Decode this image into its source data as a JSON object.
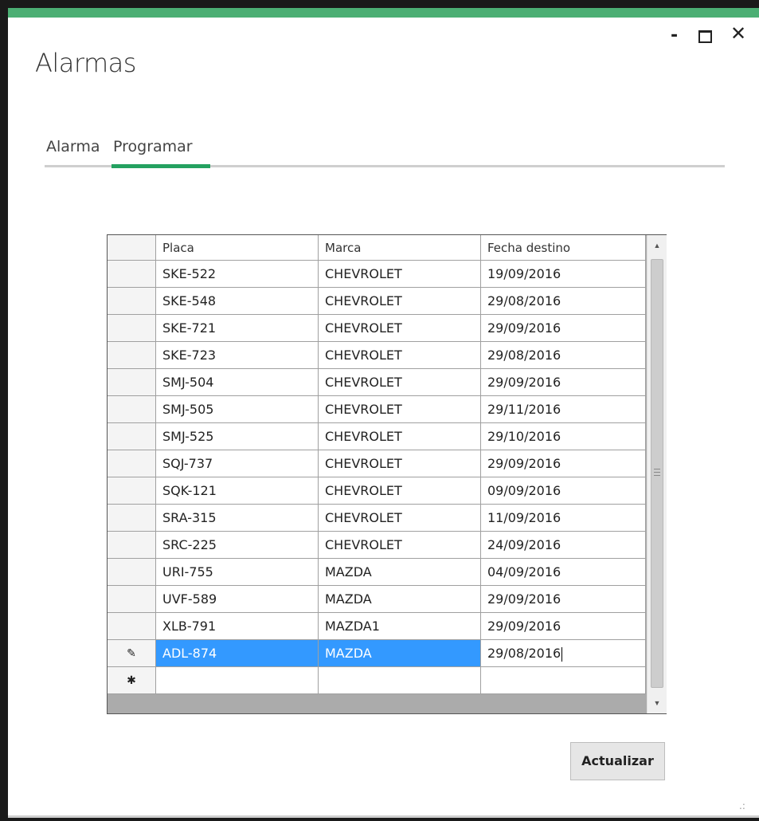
{
  "window": {
    "title": "Alarmas",
    "minimize_glyph": "-",
    "close_glyph": "✕"
  },
  "tabs": [
    {
      "label": "Alarma",
      "active": false
    },
    {
      "label": "Programar",
      "active": true
    }
  ],
  "grid": {
    "columns": [
      "Placa",
      "Marca",
      "Fecha destino"
    ],
    "rows": [
      {
        "placa": "SKE-522",
        "marca": "CHEVROLET",
        "fecha": "19/09/2016"
      },
      {
        "placa": "SKE-548",
        "marca": "CHEVROLET",
        "fecha": "29/08/2016"
      },
      {
        "placa": "SKE-721",
        "marca": "CHEVROLET",
        "fecha": "29/09/2016"
      },
      {
        "placa": "SKE-723",
        "marca": "CHEVROLET",
        "fecha": "29/08/2016"
      },
      {
        "placa": "SMJ-504",
        "marca": "CHEVROLET",
        "fecha": "29/09/2016"
      },
      {
        "placa": "SMJ-505",
        "marca": "CHEVROLET",
        "fecha": "29/11/2016"
      },
      {
        "placa": "SMJ-525",
        "marca": "CHEVROLET",
        "fecha": "29/10/2016"
      },
      {
        "placa": "SQJ-737",
        "marca": "CHEVROLET",
        "fecha": "29/09/2016"
      },
      {
        "placa": "SQK-121",
        "marca": "CHEVROLET",
        "fecha": "09/09/2016"
      },
      {
        "placa": "SRA-315",
        "marca": "CHEVROLET",
        "fecha": "11/09/2016"
      },
      {
        "placa": "SRC-225",
        "marca": "CHEVROLET",
        "fecha": "24/09/2016"
      },
      {
        "placa": "URI-755",
        "marca": "MAZDA",
        "fecha": "04/09/2016"
      },
      {
        "placa": "UVF-589",
        "marca": "MAZDA",
        "fecha": "29/09/2016"
      },
      {
        "placa": "XLB-791",
        "marca": "MAZDA1",
        "fecha": "29/09/2016"
      },
      {
        "placa": "ADL-874",
        "marca": "MAZDA",
        "fecha": "29/08/2016",
        "editing": true
      }
    ],
    "editing_row_glyph": "✎",
    "new_row_glyph": "✱"
  },
  "buttons": {
    "actualizar": "Actualizar"
  },
  "colors": {
    "accent": "#24a160",
    "topbar": "#4caf74",
    "selection": "#3399ff"
  }
}
